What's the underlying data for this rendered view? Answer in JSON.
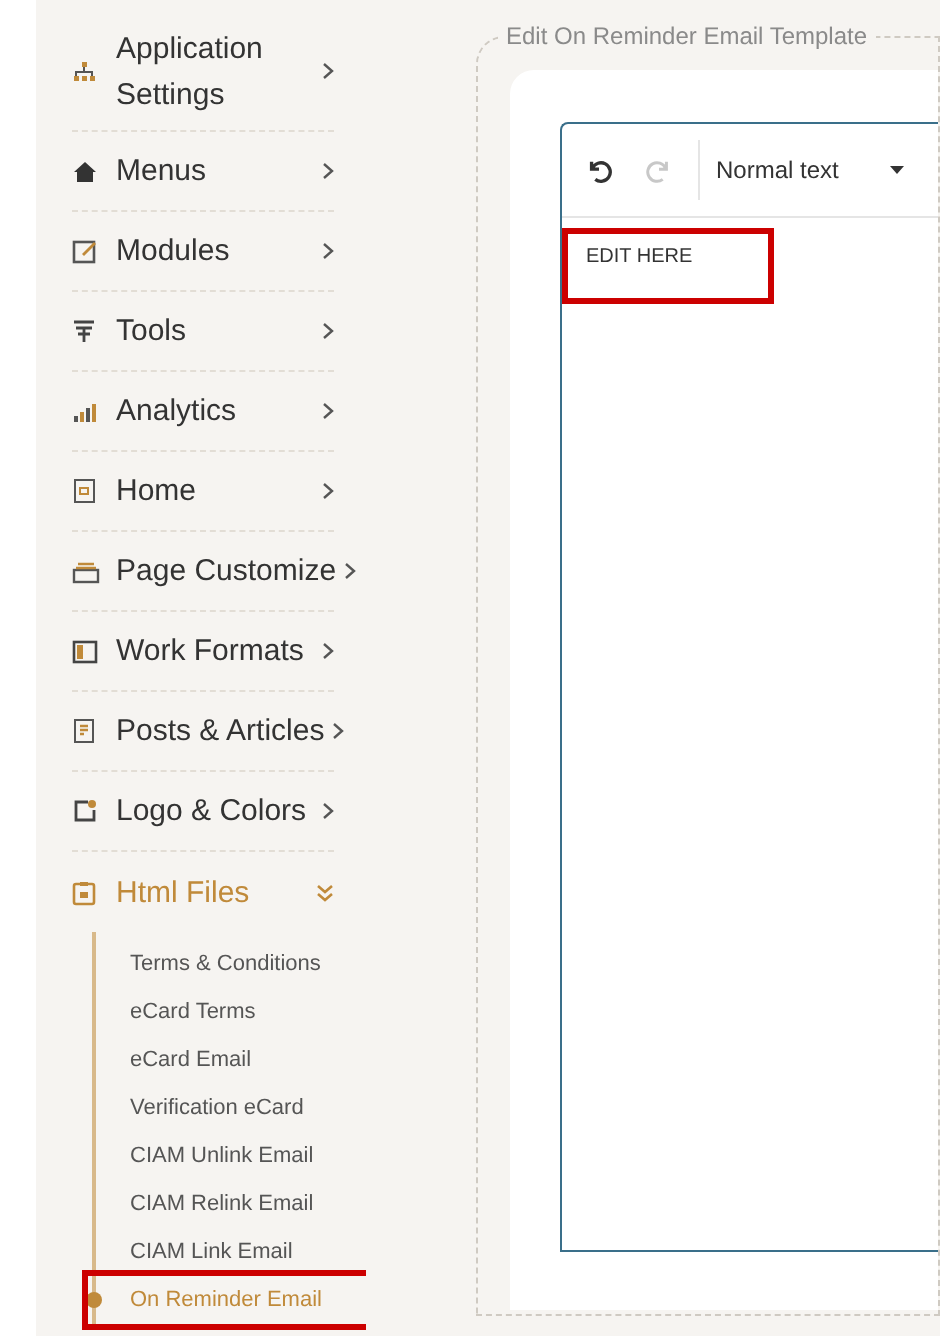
{
  "sidebar": {
    "items": [
      {
        "label": "Application Settings",
        "expanded": false
      },
      {
        "label": "Menus",
        "expanded": false
      },
      {
        "label": "Modules",
        "expanded": false
      },
      {
        "label": "Tools",
        "expanded": false
      },
      {
        "label": "Analytics",
        "expanded": false
      },
      {
        "label": "Home",
        "expanded": false
      },
      {
        "label": "Page Customize",
        "expanded": false
      },
      {
        "label": "Work Formats",
        "expanded": false
      },
      {
        "label": "Posts & Articles",
        "expanded": false
      },
      {
        "label": "Logo & Colors",
        "expanded": false
      },
      {
        "label": "Html Files",
        "expanded": true,
        "children": [
          {
            "label": "Terms & Conditions",
            "selected": false,
            "highlighted": false
          },
          {
            "label": "eCard Terms",
            "selected": false,
            "highlighted": false
          },
          {
            "label": "eCard Email",
            "selected": false,
            "highlighted": false
          },
          {
            "label": "Verification eCard",
            "selected": false,
            "highlighted": false
          },
          {
            "label": "CIAM Unlink Email",
            "selected": false,
            "highlighted": false
          },
          {
            "label": "CIAM Relink Email",
            "selected": false,
            "highlighted": false
          },
          {
            "label": "CIAM Link Email",
            "selected": false,
            "highlighted": false
          },
          {
            "label": "On Reminder Email",
            "selected": true,
            "highlighted": true
          }
        ]
      }
    ]
  },
  "editor": {
    "legend": "Edit On Reminder Email Template",
    "redo_disabled": true,
    "block_format": "Normal text",
    "content": "EDIT HERE",
    "content_highlighted": true
  }
}
